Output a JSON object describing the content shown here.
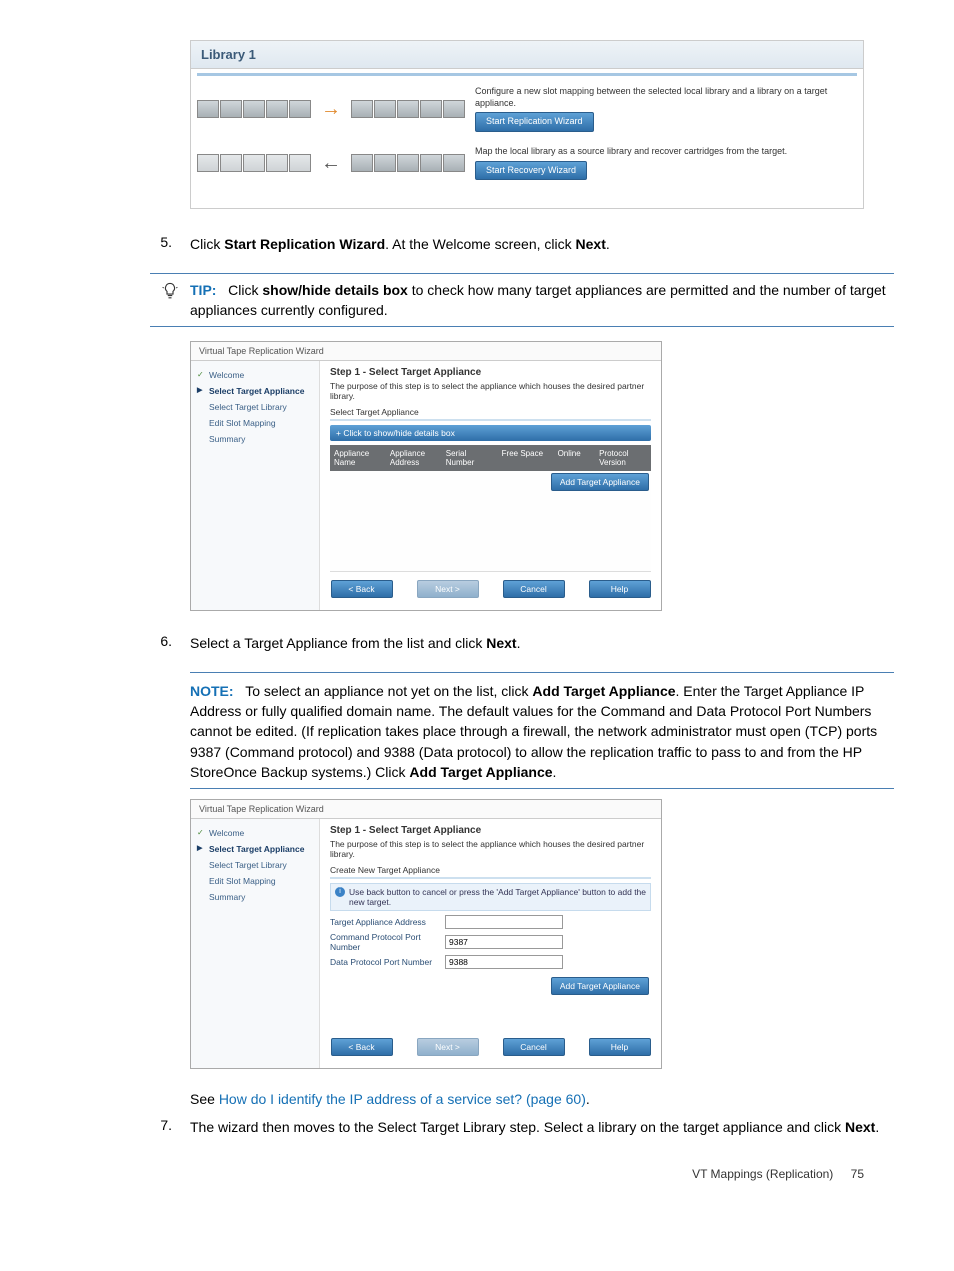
{
  "library_panel": {
    "title": "Library 1",
    "row1": {
      "desc": "Configure a new slot mapping between the selected local library and a library on a target appliance.",
      "button": "Start Replication Wizard"
    },
    "row2": {
      "desc": "Map the local library as a source library and recover cartridges from the target.",
      "button": "Start Recovery Wizard"
    }
  },
  "steps": {
    "s5": {
      "num": "5.",
      "text_pre": "Click ",
      "bold1": "Start Replication Wizard",
      "text_mid": ". At the Welcome screen, click ",
      "bold2": "Next",
      "text_post": "."
    },
    "s6": {
      "num": "6.",
      "text_pre": "Select a Target Appliance from the list and click ",
      "bold1": "Next",
      "text_post": "."
    },
    "s7": {
      "num": "7.",
      "text_pre": "The wizard then moves to the Select Target Library step. Select a library on the target appliance and click ",
      "bold1": "Next",
      "text_post": "."
    }
  },
  "tip": {
    "label": "TIP:",
    "pre": "Click ",
    "bold": "show/hide details box",
    "post": " to check how many target appliances are permitted and the number of target appliances currently configured."
  },
  "wizard1": {
    "title": "Virtual Tape Replication Wizard",
    "nav": [
      "Welcome",
      "Select Target Appliance",
      "Select Target Library",
      "Edit Slot Mapping",
      "Summary"
    ],
    "step_title": "Step 1 - Select Target Appliance",
    "desc": "The purpose of this step is to select the appliance which houses the desired partner library.",
    "subhead": "Select Target Appliance",
    "toggle": "+ Click to show/hide details box",
    "cols": [
      "Appliance Name",
      "Appliance Address",
      "Serial Number",
      "Free Space",
      "Online",
      "Protocol Version"
    ],
    "add_btn": "Add Target Appliance",
    "buttons": {
      "back": "< Back",
      "next": "Next >",
      "cancel": "Cancel",
      "help": "Help"
    }
  },
  "note": {
    "label": "NOTE:",
    "t1": "To select an appliance not yet on the list, click ",
    "b1": "Add Target Appliance",
    "t2": ". Enter the Target Appliance IP Address or fully qualified domain name. The default values for the Command and Data Protocol Port Numbers cannot be edited. (If replication takes place through a firewall, the network administrator must open (TCP) ports 9387 (Command protocol) and 9388 (Data protocol) to allow the replication traffic to pass to and from the HP StoreOnce Backup systems.) Click ",
    "b2": "Add Target Appliance",
    "t3": "."
  },
  "wizard2": {
    "title": "Virtual Tape Replication Wizard",
    "nav": [
      "Welcome",
      "Select Target Appliance",
      "Select Target Library",
      "Edit Slot Mapping",
      "Summary"
    ],
    "step_title": "Step 1 - Select Target Appliance",
    "desc": "The purpose of this step is to select the appliance which houses the desired partner library.",
    "subhead": "Create New Target Appliance",
    "info": "Use back button to cancel or press the 'Add Target Appliance' button to add the new target.",
    "fields": {
      "addr_label": "Target Appliance Address",
      "addr_val": "",
      "cmd_label": "Command Protocol Port Number",
      "cmd_val": "9387",
      "data_label": "Data Protocol Port Number",
      "data_val": "9388"
    },
    "add_btn": "Add Target Appliance",
    "buttons": {
      "back": "< Back",
      "next": "Next >",
      "cancel": "Cancel",
      "help": "Help"
    }
  },
  "see_line": {
    "pre": "See ",
    "link": "How do I identify the IP address of a service set? (page 60)",
    "post": "."
  },
  "footer": {
    "section": "VT Mappings (Replication)",
    "page": "75"
  }
}
